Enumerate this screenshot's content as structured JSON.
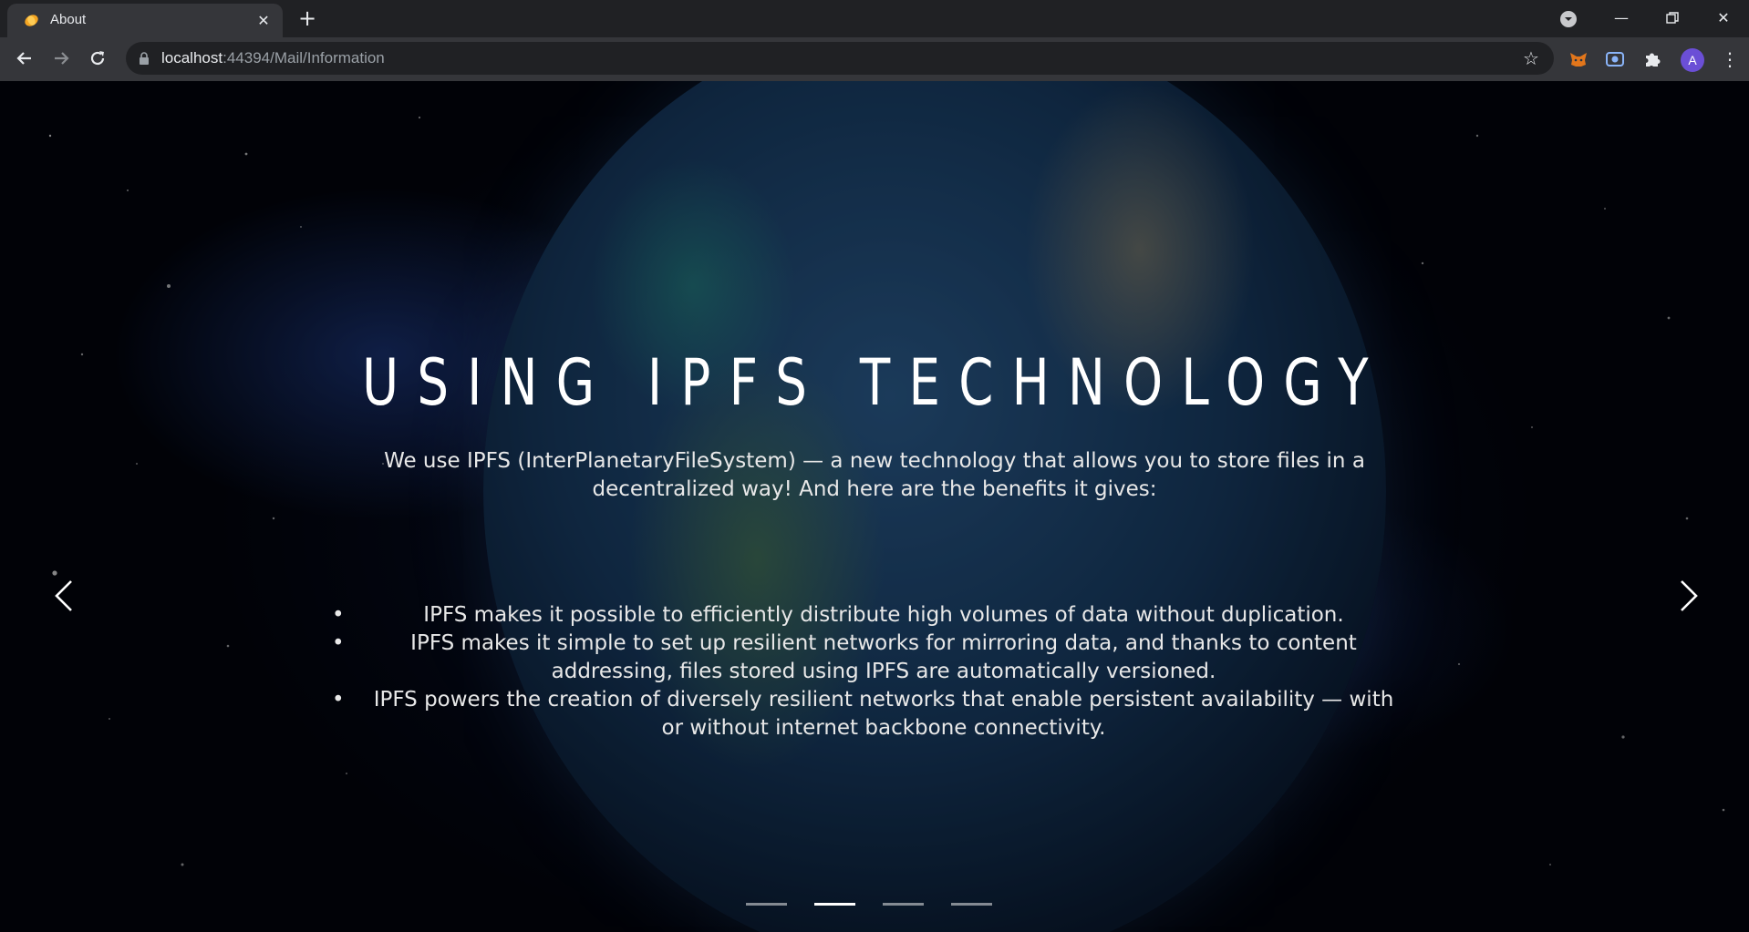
{
  "browser": {
    "tab_title": "About",
    "url_host": "localhost",
    "url_path": ":44394/Mail/Information",
    "avatar_letter": "A"
  },
  "slide": {
    "headline": "USING IPFS TECHNOLOGY",
    "intro": "We use IPFS (InterPlanetaryFileSystem) — a new technology that allows you to store files in a decentralized way! And here are the benefits it gives:",
    "benefits": [
      "IPFS makes it possible to efficiently distribute high volumes of data without duplication.",
      "IPFS makes it simple to set up resilient networks for mirroring data, and thanks to content addressing, files stored using IPFS are automatically versioned.",
      "IPFS powers the creation of diversely resilient networks that enable persistent availability — with or without internet backbone connectivity."
    ]
  },
  "carousel": {
    "slide_count": 4,
    "active_index": 1
  },
  "colors": {
    "chrome_dark": "#202124",
    "chrome_toolbar": "#35363a",
    "avatar": "#6b4fd6"
  }
}
